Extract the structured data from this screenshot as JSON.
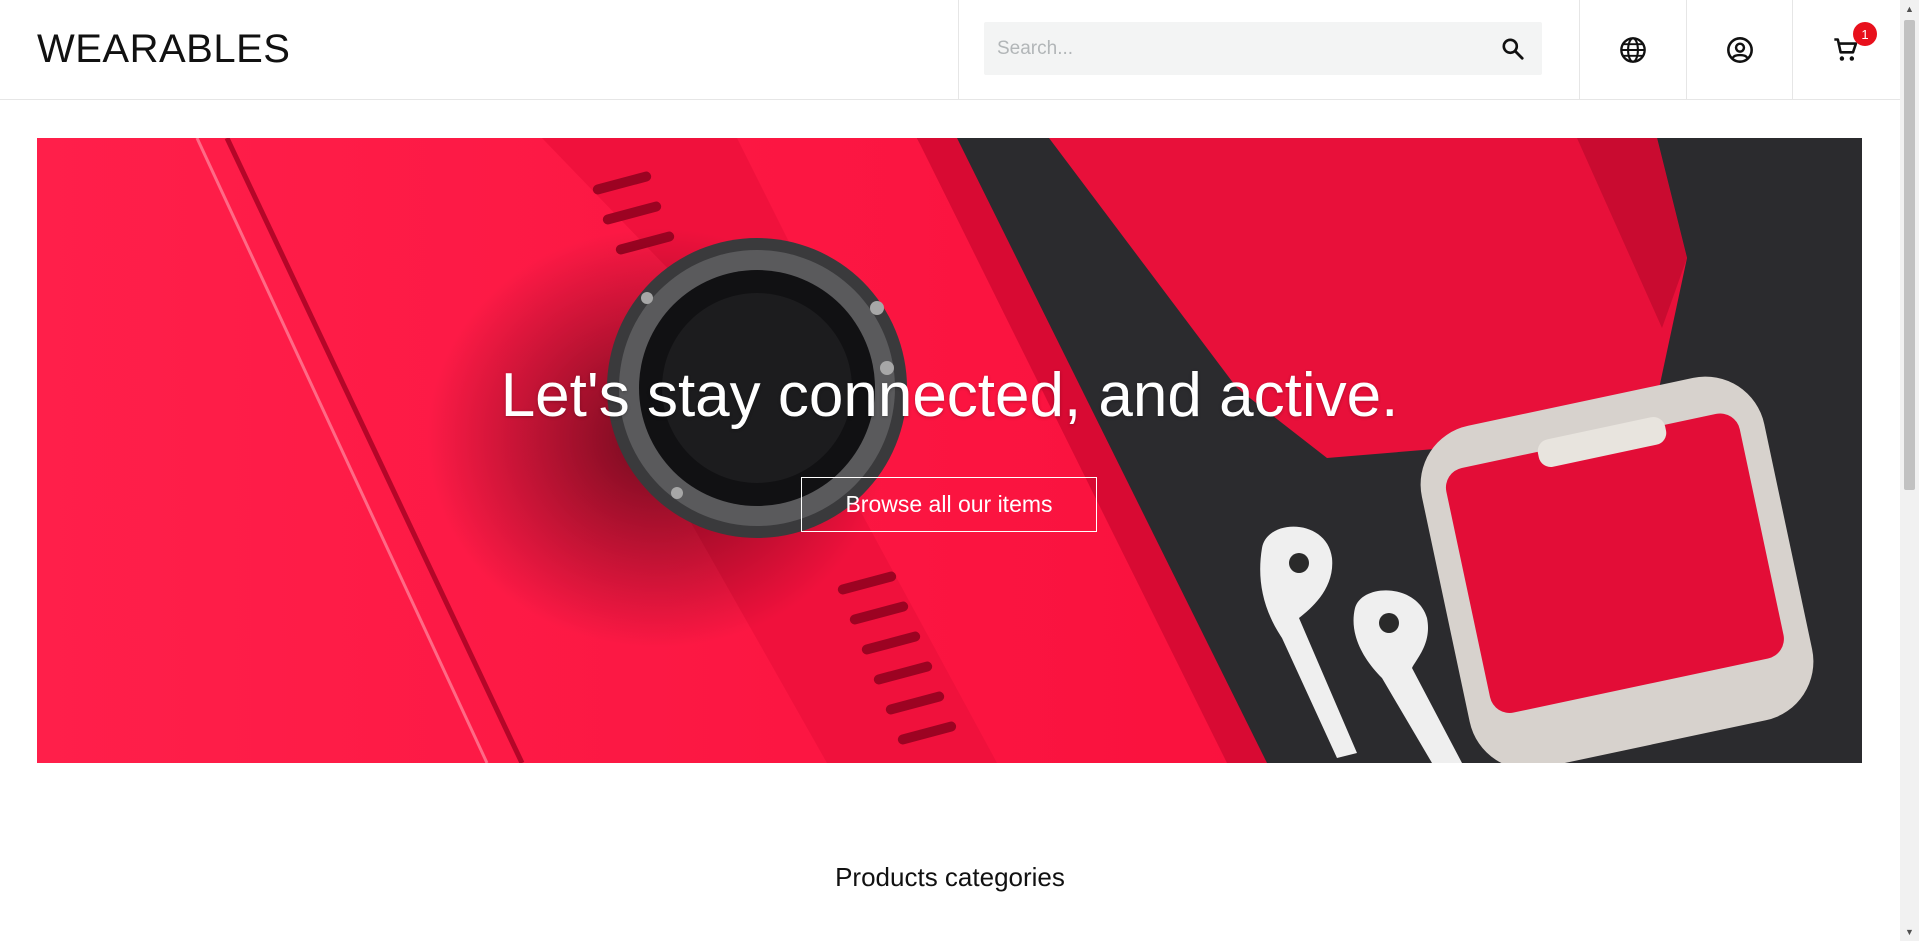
{
  "header": {
    "logo": "WEARABLES",
    "search": {
      "placeholder": "Search...",
      "value": ""
    },
    "cart": {
      "badge_count": "1"
    }
  },
  "icons": {
    "search": "search-icon",
    "language": "globe-icon",
    "account": "account-circle-icon",
    "cart": "cart-icon"
  },
  "hero": {
    "title": "Let's stay connected, and active.",
    "cta_label": "Browse all our items"
  },
  "sections": {
    "categories_title": "Products categories"
  },
  "colors": {
    "accent_red": "#ff0f3c",
    "badge_red": "#e8101c",
    "dark_surface": "#2b2b2e",
    "search_bg": "#f3f4f4"
  }
}
